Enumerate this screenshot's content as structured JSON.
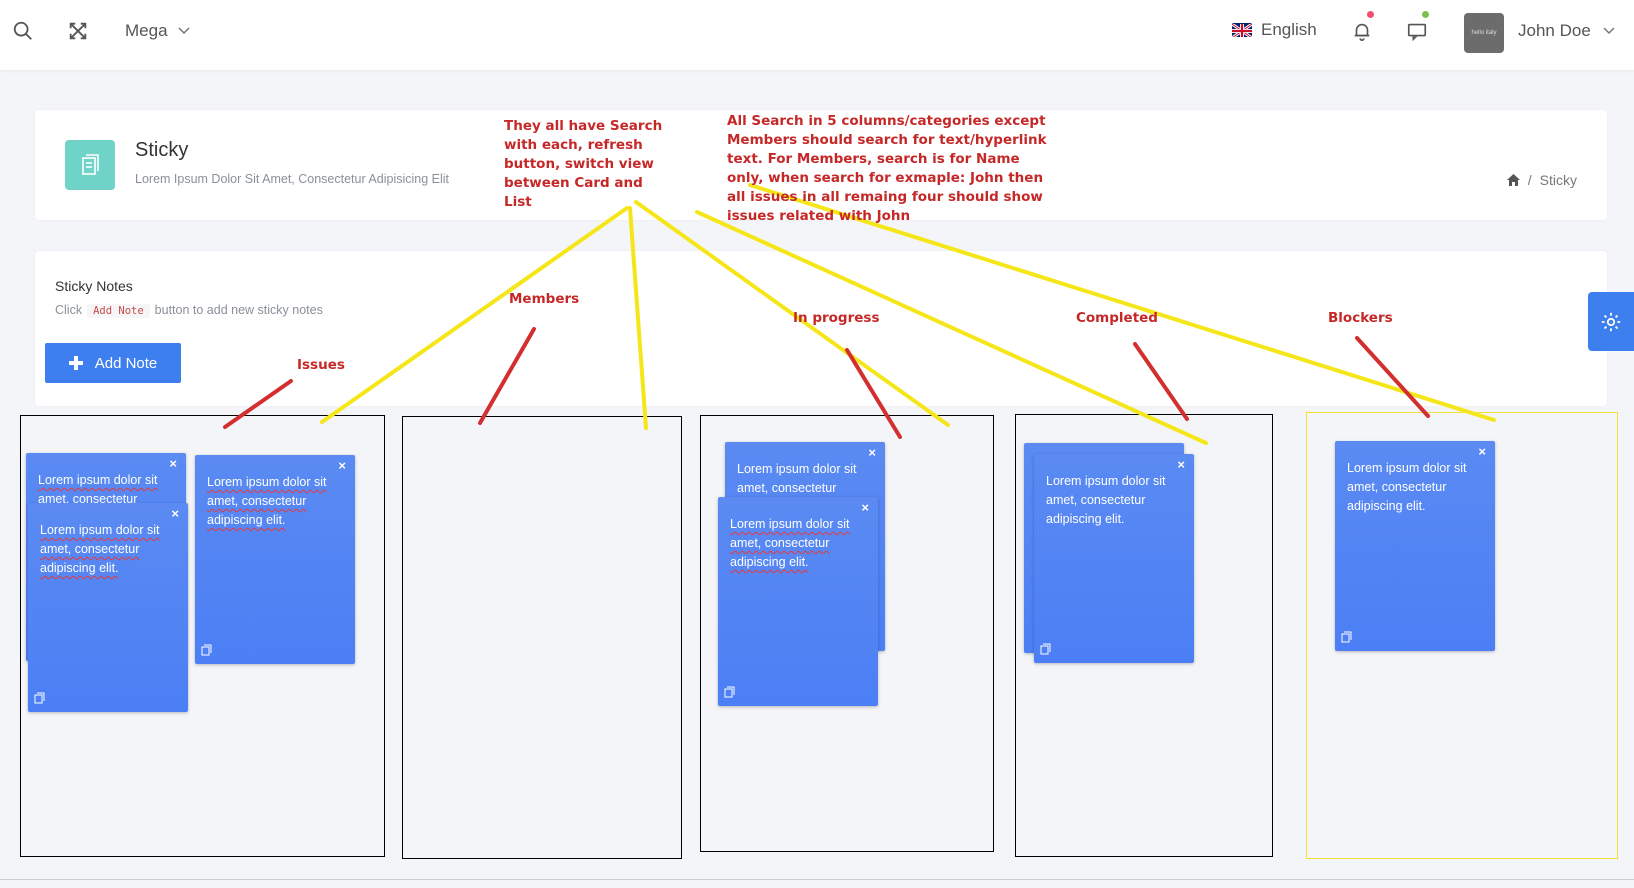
{
  "topbar": {
    "mega_label": "Mega",
    "language": "English",
    "user_name": "John Doe",
    "avatar_text": "hello italy"
  },
  "header": {
    "title": "Sticky",
    "subtitle": "Lorem Ipsum Dolor Sit Amet, Consectetur Adipisicing Elit",
    "breadcrumb_current": "Sticky",
    "breadcrumb_sep": "/"
  },
  "notes_panel": {
    "title": "Sticky Notes",
    "help_prefix": "Click",
    "help_code": "Add Note",
    "help_suffix": "button to add new sticky notes",
    "add_button": "Add Note"
  },
  "note_text": "Lorem ipsum dolor sit amet, consectetur adipiscing elit.",
  "note_text_cut": "Lorem ipsum dolor sit amet, consectetur",
  "close_glyph": "×",
  "annotations": {
    "shared": "They all have Search with each, refresh button, switch view between Card and List",
    "search": "All Search in 5 columns/categories except Members should search for text/hyperlink text. For Members, search is for Name only, when search for exmaple: John then all issues in all remaing four should show issues related with John",
    "issues": "Issues",
    "members": "Members",
    "in_progress": "In progress",
    "completed": "Completed",
    "blockers": "Blockers"
  },
  "colors": {
    "accent": "#3e7ff0",
    "note": "#4c7ff5",
    "annotation_red": "#d32f2f",
    "annotation_yellow": "#f5e61a",
    "page_icon": "#6fd3c7"
  }
}
